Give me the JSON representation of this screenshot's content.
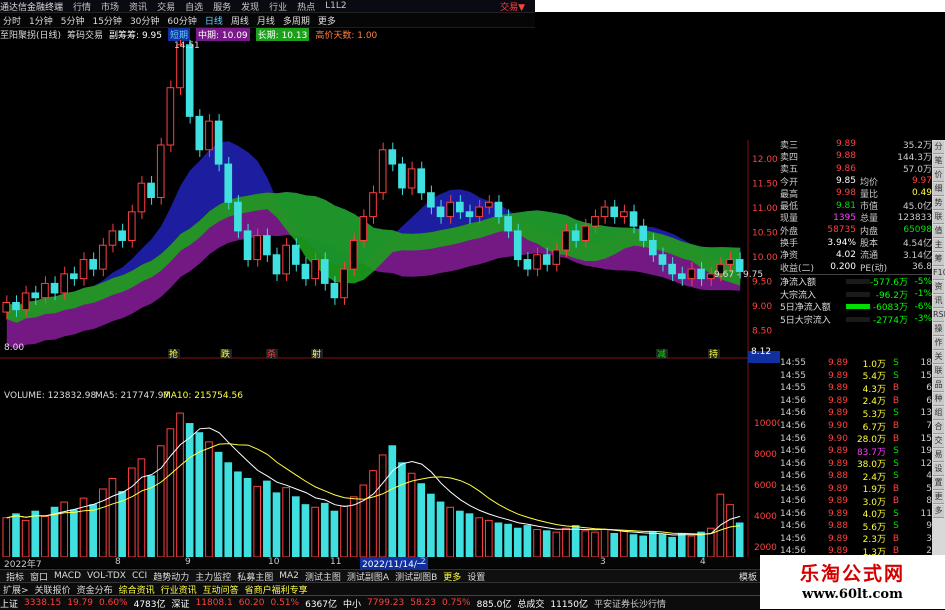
{
  "title_bar": {
    "app_name": "通达信金融终端",
    "menus": [
      "行情",
      "市场",
      "资讯",
      "交易",
      "自选",
      "服务",
      "发现",
      "行业",
      "热点",
      "L1L2"
    ],
    "trade_button": "交易▼"
  },
  "toolbar": {
    "buttons": [
      "分时",
      "1分钟",
      "5分钟",
      "15分钟",
      "30分钟",
      "60分钟",
      "日线",
      "周线",
      "月线",
      "多周期",
      "更多"
    ],
    "active_index": 6
  },
  "indicator_bar": {
    "main_label": "至阳聚拐(日线)",
    "chips_label": "筹码交易",
    "price_label": "副筹筹: 9.95",
    "short_label": "短期",
    "mid_label": "中期: 10.09",
    "long_label": "长期: 10.13",
    "cost_label": "高价天数: 1.00"
  },
  "main_chart": {
    "high_label": "14.51",
    "low_label": "8.00",
    "last_range_label": "9.67 - 9.75",
    "right_axis": [
      "12.00",
      "11.50",
      "11.00",
      "10.50",
      "10.00",
      "9.50",
      "9.00",
      "8.50"
    ],
    "current_tag": "8.12",
    "signal_labels": [
      {
        "text": "抢",
        "color": "#ffff40"
      },
      {
        "text": "跌",
        "color": "#ffff40"
      },
      {
        "text": "杀",
        "color": "#ff4040"
      },
      {
        "text": "射",
        "color": "#ffff40"
      },
      {
        "text": "减",
        "color": "#00e000"
      },
      {
        "text": "持",
        "color": "#ffff40"
      }
    ]
  },
  "volume_chart": {
    "header_volume": "VOLUME: 123832.98",
    "header_ma5": "MA5: 217747.97",
    "header_ma10": "MA10: 215754.56",
    "right_axis": [
      "10000",
      "8000",
      "6000",
      "4000",
      "2000"
    ]
  },
  "date_axis": [
    "2022年7",
    "8",
    "9",
    "10",
    "11",
    "2022/11/14/一",
    "2",
    "3",
    "4"
  ],
  "quote_panel": {
    "top_rows": [
      {
        "label": "卖三",
        "v1": "9.89",
        "v1c": "#ff4040",
        "v2": "",
        "label2": "",
        "v3": "35.2万",
        "v3c": "#cccccc"
      },
      {
        "label": "卖四",
        "v1": "9.88",
        "v1c": "#ff4040",
        "v2": "",
        "label2": "",
        "v3": "144.3万",
        "v3c": "#cccccc"
      },
      {
        "label": "卖五",
        "v1": "9.86",
        "v1c": "#ff4040",
        "v2": "",
        "label2": "",
        "v3": "57.0万",
        "v3c": "#cccccc"
      },
      {
        "label": "今开",
        "v1": "9.85",
        "v1c": "#ffffff",
        "v2": "",
        "label2": "均价",
        "v3": "9.97",
        "v3c": "#ff4040"
      },
      {
        "label": "最高",
        "v1": "9.98",
        "v1c": "#ff4040",
        "v2": "",
        "label2": "量比",
        "v3": "0.49",
        "v3c": "#ffff40"
      },
      {
        "label": "最低",
        "v1": "9.81",
        "v1c": "#00e000",
        "v2": "",
        "label2": "市值",
        "v3": "45.0亿",
        "v3c": "#cccccc"
      },
      {
        "label": "现量",
        "v1": "1395",
        "v1c": "#ff40ff",
        "v2": "",
        "label2": "总量",
        "v3": "123833",
        "v3c": "#cccccc"
      },
      {
        "label": "外盘",
        "v1": "58735",
        "v1c": "#ff4040",
        "v2": "",
        "label2": "内盘",
        "v3": "65098",
        "v3c": "#00e000"
      },
      {
        "label": "换手",
        "v1": "3.94%",
        "v1c": "#ffffff",
        "v2": "",
        "label2": "股本",
        "v3": "4.54亿",
        "v3c": "#cccccc"
      },
      {
        "label": "净资",
        "v1": "4.02",
        "v1c": "#ffffff",
        "v2": "",
        "label2": "流通",
        "v3": "3.14亿",
        "v3c": "#cccccc"
      },
      {
        "label": "收益(二)",
        "v1": "0.200",
        "v1c": "#ffffff",
        "v2": "",
        "label2": "PE(动)",
        "v3": "36.8",
        "v3c": "#cccccc"
      }
    ],
    "flows": [
      {
        "label": "净流入额",
        "value": "-577.6万",
        "pct": "-5%"
      },
      {
        "label": "大宗流入",
        "value": "-96.2万",
        "pct": "-1%"
      },
      {
        "label": "5日净流入额",
        "value": "-6083万",
        "pct": "-6%"
      },
      {
        "label": "5日大宗流入",
        "value": "-2774万",
        "pct": "-3%"
      }
    ],
    "ticks": [
      {
        "t": "14:55",
        "p": "9.89",
        "q": "1.0万",
        "qc": "#ffff40",
        "d": "S",
        "dc": "#00e000",
        "c": "18"
      },
      {
        "t": "14:55",
        "p": "9.89",
        "q": "5.4万",
        "qc": "#ffff40",
        "d": "S",
        "dc": "#00e000",
        "c": "15"
      },
      {
        "t": "14:55",
        "p": "9.89",
        "q": "4.3万",
        "qc": "#ffff40",
        "d": "B",
        "dc": "#ff4040",
        "c": "6"
      },
      {
        "t": "14:56",
        "p": "9.89",
        "q": "2.4万",
        "qc": "#ffff40",
        "d": "B",
        "dc": "#ff4040",
        "c": "6"
      },
      {
        "t": "14:56",
        "p": "9.89",
        "q": "5.3万",
        "qc": "#ffff40",
        "d": "S",
        "dc": "#00e000",
        "c": "13"
      },
      {
        "t": "14:56",
        "p": "9.90",
        "q": "6.7万",
        "qc": "#ffff40",
        "d": "B",
        "dc": "#ff4040",
        "c": "7"
      },
      {
        "t": "14:56",
        "p": "9.90",
        "q": "28.0万",
        "qc": "#ffff40",
        "d": "B",
        "dc": "#ff4040",
        "c": "15"
      },
      {
        "t": "14:56",
        "p": "9.89",
        "q": "83.7万",
        "qc": "#ff40ff",
        "d": "S",
        "dc": "#00e000",
        "c": "19"
      },
      {
        "t": "14:56",
        "p": "9.89",
        "q": "38.0万",
        "qc": "#ffff40",
        "d": "S",
        "dc": "#00e000",
        "c": "12"
      },
      {
        "t": "14:56",
        "p": "9.88",
        "q": "2.4万",
        "qc": "#ffff40",
        "d": "S",
        "dc": "#00e000",
        "c": "4"
      },
      {
        "t": "14:56",
        "p": "9.89",
        "q": "1.9万",
        "qc": "#ffff40",
        "d": "B",
        "dc": "#ff4040",
        "c": "5"
      },
      {
        "t": "14:56",
        "p": "9.89",
        "q": "3.0万",
        "qc": "#ffff40",
        "d": "B",
        "dc": "#ff4040",
        "c": "8"
      },
      {
        "t": "14:56",
        "p": "9.89",
        "q": "4.0万",
        "qc": "#ffff40",
        "d": "S",
        "dc": "#00e000",
        "c": "11"
      },
      {
        "t": "14:56",
        "p": "9.88",
        "q": "5.6万",
        "qc": "#ffff40",
        "d": "S",
        "dc": "#00e000",
        "c": "9"
      },
      {
        "t": "14:56",
        "p": "9.89",
        "q": "2.3万",
        "qc": "#ffff40",
        "d": "B",
        "dc": "#ff4040",
        "c": "3"
      },
      {
        "t": "14:56",
        "p": "9.89",
        "q": "1.3万",
        "qc": "#ffff40",
        "d": "B",
        "dc": "#ff4040",
        "c": "2"
      }
    ]
  },
  "side_tabs": [
    "分",
    "笔",
    "价",
    "细",
    "势",
    "联",
    "值",
    "主",
    "筹",
    "F10",
    "资",
    "讯",
    "RSI",
    "操",
    "作",
    "关",
    "联",
    "品",
    "种",
    "组",
    "合",
    "交",
    "易",
    "设",
    "置",
    "更",
    "多"
  ],
  "tab_bar": [
    "指标",
    "窗口",
    "MACD",
    "VOL-TDX",
    "CCI",
    "趋势动力",
    "主力监控",
    "私募主图",
    "MA2",
    "测试主图",
    "测试副图A",
    "测试副图B",
    "更多",
    "设置"
  ],
  "tab_bar_right": "模板",
  "tab_bar2": [
    "扩展>",
    "关联报价",
    "资金分布",
    "综合资讯",
    "行业资讯",
    "互动问答",
    "省商户福利专享"
  ],
  "status_bar": {
    "items": [
      {
        "text": "上证",
        "color": "#ffffff"
      },
      {
        "text": "3338.15",
        "color": "#ff4040"
      },
      {
        "text": "19.79",
        "color": "#ff4040"
      },
      {
        "text": "0.60%",
        "color": "#ff4040"
      },
      {
        "text": "4783亿",
        "color": "#ffffff"
      },
      {
        "text": "深证",
        "color": "#ffffff"
      },
      {
        "text": "11808.1",
        "color": "#ff4040"
      },
      {
        "text": "60.20",
        "color": "#ff4040"
      },
      {
        "text": "0.51%",
        "color": "#ff4040"
      },
      {
        "text": "6367亿",
        "color": "#ffffff"
      },
      {
        "text": "中小",
        "color": "#ffffff"
      },
      {
        "text": "7799.23",
        "color": "#ff4040"
      },
      {
        "text": "58.23",
        "color": "#ff4040"
      },
      {
        "text": "0.75%",
        "color": "#ff4040"
      },
      {
        "text": "885.0亿",
        "color": "#ffffff"
      },
      {
        "text": "总成交",
        "color": "#ffffff"
      },
      {
        "text": "11150亿",
        "color": "#ffffff"
      },
      {
        "text": "平安证券长沙行情",
        "color": "#cccccc"
      }
    ]
  },
  "watermark": {
    "title": "乐淘公式网",
    "url": "www.60lt.com"
  },
  "colors": {
    "up": "#ff4040",
    "down": "#40e0e0",
    "green_band": "#1ca01c",
    "purple_band": "#7a1a8a",
    "blue_band": "#2020b0"
  },
  "chart_data": {
    "type": "candlestick",
    "title": "",
    "ylim": [
      8.0,
      14.6
    ],
    "candles": [
      {
        "o": 8.9,
        "c": 9.1
      },
      {
        "o": 9.1,
        "c": 8.95
      },
      {
        "o": 8.95,
        "c": 9.3
      },
      {
        "o": 9.3,
        "c": 9.2
      },
      {
        "o": 9.2,
        "c": 9.5
      },
      {
        "o": 9.5,
        "c": 9.3
      },
      {
        "o": 9.3,
        "c": 9.7
      },
      {
        "o": 9.7,
        "c": 9.6
      },
      {
        "o": 9.6,
        "c": 10.0
      },
      {
        "o": 10.0,
        "c": 9.8
      },
      {
        "o": 9.8,
        "c": 10.3
      },
      {
        "o": 10.3,
        "c": 10.6
      },
      {
        "o": 10.6,
        "c": 10.4
      },
      {
        "o": 10.4,
        "c": 11.0
      },
      {
        "o": 11.0,
        "c": 11.6
      },
      {
        "o": 11.6,
        "c": 11.3
      },
      {
        "o": 11.3,
        "c": 12.4
      },
      {
        "o": 12.4,
        "c": 13.6
      },
      {
        "o": 13.6,
        "c": 14.5
      },
      {
        "o": 14.5,
        "c": 13.0
      },
      {
        "o": 13.0,
        "c": 12.3
      },
      {
        "o": 12.3,
        "c": 12.9
      },
      {
        "o": 12.9,
        "c": 12.0
      },
      {
        "o": 12.0,
        "c": 11.2
      },
      {
        "o": 11.2,
        "c": 10.6
      },
      {
        "o": 10.6,
        "c": 10.0
      },
      {
        "o": 10.0,
        "c": 10.5
      },
      {
        "o": 10.5,
        "c": 10.1
      },
      {
        "o": 10.1,
        "c": 9.7
      },
      {
        "o": 9.7,
        "c": 10.3
      },
      {
        "o": 10.3,
        "c": 9.9
      },
      {
        "o": 9.9,
        "c": 9.6
      },
      {
        "o": 9.6,
        "c": 10.0
      },
      {
        "o": 10.0,
        "c": 9.5
      },
      {
        "o": 9.5,
        "c": 9.2
      },
      {
        "o": 9.2,
        "c": 9.8
      },
      {
        "o": 9.8,
        "c": 10.4
      },
      {
        "o": 10.4,
        "c": 10.9
      },
      {
        "o": 10.9,
        "c": 11.4
      },
      {
        "o": 11.4,
        "c": 12.3
      },
      {
        "o": 12.3,
        "c": 12.0
      },
      {
        "o": 12.0,
        "c": 11.5
      },
      {
        "o": 11.5,
        "c": 11.9
      },
      {
        "o": 11.9,
        "c": 11.4
      },
      {
        "o": 11.4,
        "c": 11.1
      },
      {
        "o": 11.1,
        "c": 10.9
      },
      {
        "o": 10.9,
        "c": 11.2
      },
      {
        "o": 11.2,
        "c": 11.0
      },
      {
        "o": 11.0,
        "c": 10.9
      },
      {
        "o": 10.9,
        "c": 11.1
      },
      {
        "o": 11.1,
        "c": 11.2
      },
      {
        "o": 11.2,
        "c": 10.9
      },
      {
        "o": 10.9,
        "c": 10.6
      },
      {
        "o": 10.6,
        "c": 10.0
      },
      {
        "o": 10.0,
        "c": 9.8
      },
      {
        "o": 9.8,
        "c": 10.1
      },
      {
        "o": 10.1,
        "c": 9.9
      },
      {
        "o": 9.9,
        "c": 10.2
      },
      {
        "o": 10.2,
        "c": 10.6
      },
      {
        "o": 10.6,
        "c": 10.4
      },
      {
        "o": 10.4,
        "c": 10.7
      },
      {
        "o": 10.7,
        "c": 10.9
      },
      {
        "o": 10.9,
        "c": 11.1
      },
      {
        "o": 11.1,
        "c": 10.9
      },
      {
        "o": 10.9,
        "c": 11.0
      },
      {
        "o": 11.0,
        "c": 10.7
      },
      {
        "o": 10.7,
        "c": 10.4
      },
      {
        "o": 10.4,
        "c": 10.1
      },
      {
        "o": 10.1,
        "c": 9.9
      },
      {
        "o": 9.9,
        "c": 9.7
      },
      {
        "o": 9.7,
        "c": 9.6
      },
      {
        "o": 9.6,
        "c": 9.8
      },
      {
        "o": 9.8,
        "c": 9.6
      },
      {
        "o": 9.6,
        "c": 9.7
      },
      {
        "o": 9.7,
        "c": 9.9
      },
      {
        "o": 9.9,
        "c": 10.0
      },
      {
        "o": 10.0,
        "c": 9.75
      }
    ],
    "volume": [
      3.0,
      3.3,
      2.8,
      3.5,
      3.1,
      3.8,
      4.2,
      3.6,
      4.5,
      4.0,
      5.2,
      6.0,
      5.0,
      6.8,
      7.5,
      6.2,
      8.5,
      9.8,
      11.0,
      10.2,
      9.5,
      8.8,
      8.0,
      7.2,
      6.5,
      6.0,
      5.4,
      5.8,
      4.9,
      5.3,
      4.6,
      4.0,
      3.8,
      4.1,
      3.5,
      3.9,
      4.6,
      5.5,
      6.6,
      7.8,
      8.5,
      7.2,
      6.4,
      5.6,
      4.8,
      4.2,
      3.8,
      3.5,
      3.3,
      3.0,
      2.8,
      2.6,
      2.5,
      2.2,
      2.4,
      2.1,
      2.0,
      1.9,
      2.2,
      2.4,
      2.0,
      1.9,
      2.1,
      1.8,
      2.0,
      1.7,
      1.6,
      1.9,
      1.7,
      1.5,
      1.8,
      1.6,
      1.9,
      2.2,
      4.8,
      4.0,
      2.6
    ],
    "volume_unit": "千手"
  }
}
